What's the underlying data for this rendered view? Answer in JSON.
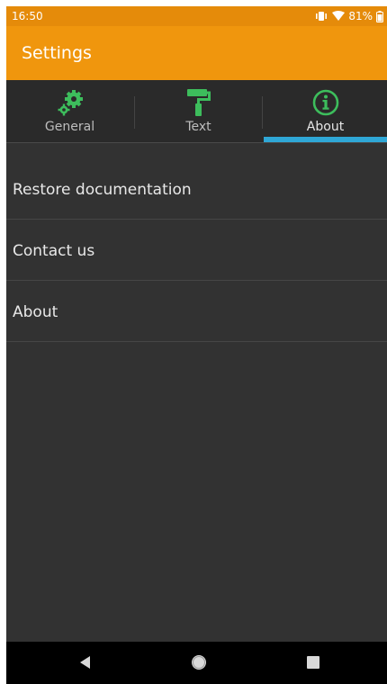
{
  "status_bar": {
    "time": "16:50",
    "battery_percent": "81%",
    "icons": [
      "vibrate-icon",
      "wifi-icon",
      "battery-icon"
    ]
  },
  "app_bar": {
    "title": "Settings"
  },
  "tabs": [
    {
      "label": "General",
      "icon": "gears-icon",
      "active": false
    },
    {
      "label": "Text",
      "icon": "paint-roller-icon",
      "active": false
    },
    {
      "label": "About",
      "icon": "info-icon",
      "active": true
    }
  ],
  "list": {
    "items": [
      {
        "label": "Restore documentation"
      },
      {
        "label": "Contact us"
      },
      {
        "label": "About"
      }
    ]
  },
  "nav_bar": {
    "buttons": [
      "back-icon",
      "home-icon",
      "recents-icon"
    ]
  },
  "colors": {
    "status_bar": "#e58b0a",
    "app_bar": "#f0960d",
    "background": "#323232",
    "tab_bar": "#2a2a2a",
    "icon_green": "#3dbd5c",
    "tab_indicator": "#2fa7d6",
    "text": "#e8e8e8"
  }
}
